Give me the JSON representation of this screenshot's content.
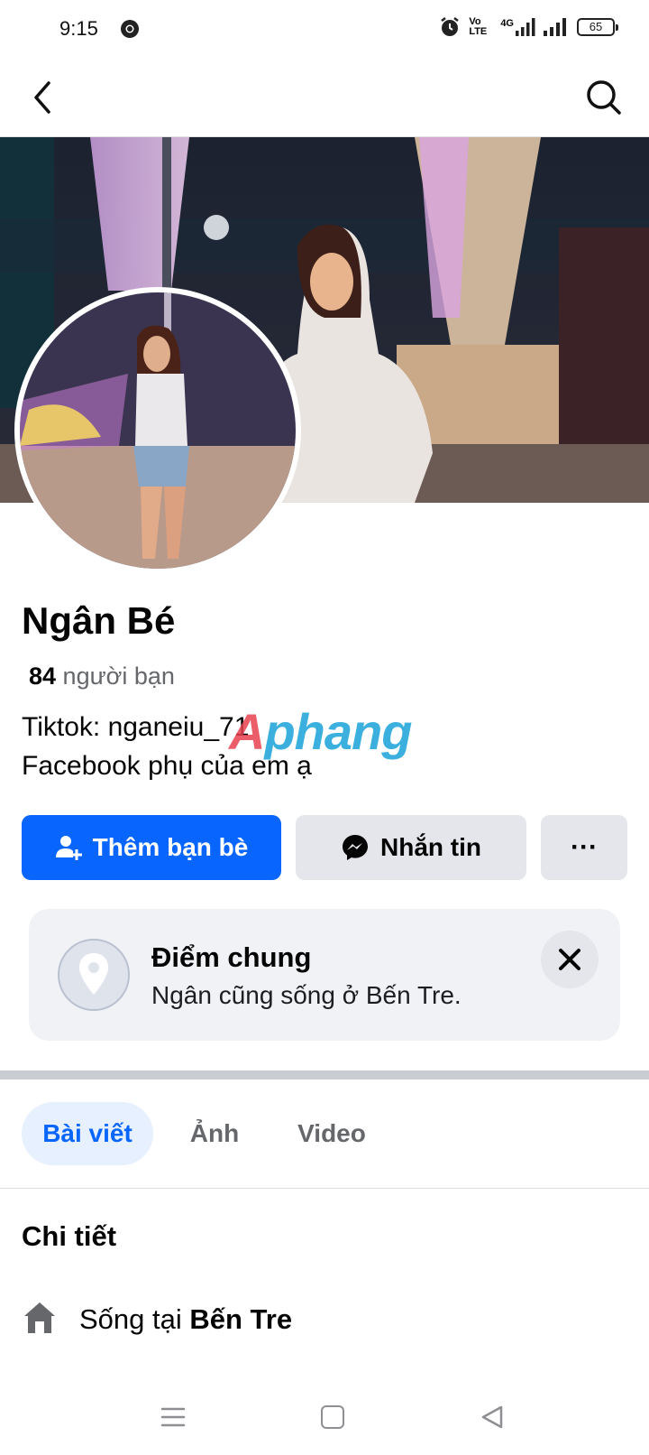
{
  "status_bar": {
    "time": "9:15",
    "network": "4G",
    "volte": "Vo LTE",
    "battery": "65",
    "icons": [
      "chrome-icon",
      "alarm-icon",
      "volte-icon",
      "signal-icon",
      "signal-icon",
      "battery-icon"
    ]
  },
  "nav": {
    "back_icon": "chevron-left-icon",
    "search_icon": "search-icon"
  },
  "profile": {
    "name": "Ngân Bé",
    "friend_count": "84",
    "friend_label": " người bạn",
    "bio_line1": "Tiktok: nganeiu_71",
    "bio_line2": "Facebook phụ của em ạ"
  },
  "watermark": {
    "first": "A",
    "rest": "phang"
  },
  "actions": {
    "add_friend": "Thêm bạn bè",
    "message": "Nhắn tin",
    "more": "···"
  },
  "common_point": {
    "title": "Điểm chung",
    "subtitle": "Ngân cũng sống ở Bến Tre."
  },
  "tabs": [
    {
      "label": "Bài viết",
      "active": true
    },
    {
      "label": "Ảnh",
      "active": false
    },
    {
      "label": "Video",
      "active": false
    }
  ],
  "details": {
    "title": "Chi tiết",
    "lives_prefix": "Sống tại ",
    "lives_place": "Bến Tre"
  },
  "colors": {
    "primary": "#0866ff",
    "secondary_bg": "#e4e6eb",
    "card_bg": "#f0f2f5",
    "active_tab_bg": "#e7f0fe"
  }
}
